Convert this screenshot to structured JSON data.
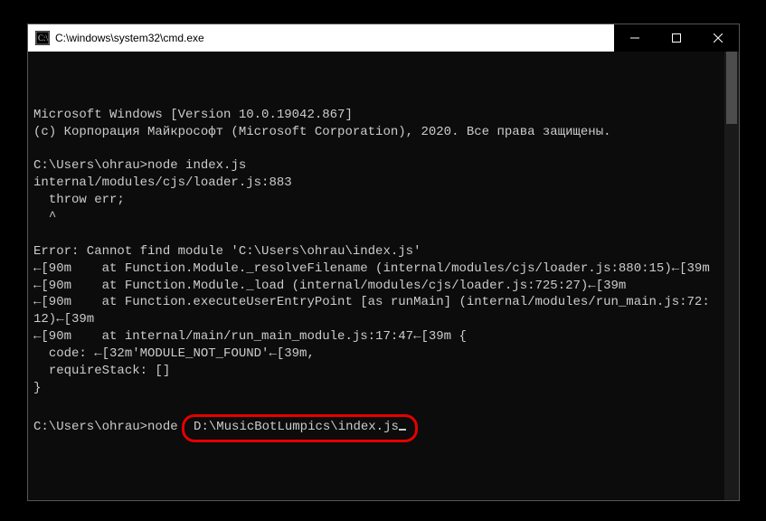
{
  "titlebar": {
    "title": "C:\\windows\\system32\\cmd.exe"
  },
  "terminal": {
    "line1": "Microsoft Windows [Version 10.0.19042.867]",
    "line2": "(c) Корпорация Майкрософт (Microsoft Corporation), 2020. Все права защищены.",
    "prompt1_prefix": "C:\\Users\\ohrau>",
    "prompt1_cmd": "node index.js",
    "err1": "internal/modules/cjs/loader.js:883",
    "err2": "  throw err;",
    "err3": "  ^",
    "err4": "Error: Cannot find module 'C:\\Users\\ohrau\\index.js'",
    "err5": "←[90m    at Function.Module._resolveFilename (internal/modules/cjs/loader.js:880:15)←[39m",
    "err6": "←[90m    at Function.Module._load (internal/modules/cjs/loader.js:725:27)←[39m",
    "err7": "←[90m    at Function.executeUserEntryPoint [as runMain] (internal/modules/run_main.js:72:12)←[39m",
    "err8": "←[90m    at internal/main/run_main_module.js:17:47←[39m {",
    "err9": "  code: ←[32m'MODULE_NOT_FOUND'←[39m,",
    "err10": "  requireStack: []",
    "err11": "}",
    "prompt2_prefix": "C:\\Users\\ohrau>",
    "prompt2_cmd_before": "node ",
    "prompt2_cmd_highlight": "D:\\MusicBotLumpics\\index.js"
  }
}
